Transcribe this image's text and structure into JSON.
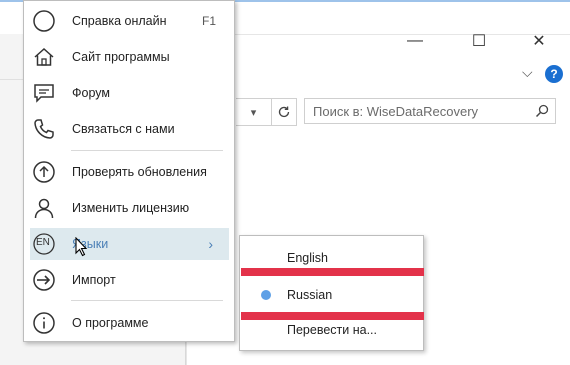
{
  "menu": {
    "items": [
      {
        "label": "Справка онлайн",
        "shortcut": "F1",
        "icon": "help-circle-icon"
      },
      {
        "label": "Сайт программы",
        "icon": "home-icon"
      },
      {
        "label": "Форум",
        "icon": "forum-icon"
      },
      {
        "label": "Связаться с нами",
        "icon": "phone-icon"
      },
      {
        "label": "Проверять обновления",
        "icon": "arrow-up-circle-icon"
      },
      {
        "label": "Изменить лицензию",
        "icon": "person-icon"
      },
      {
        "label": "Языки",
        "icon": "language-icon",
        "badge": "EN"
      },
      {
        "label": "Импорт",
        "icon": "import-icon"
      },
      {
        "label": "О программе",
        "icon": "info-icon"
      }
    ]
  },
  "languages_submenu": {
    "items": [
      {
        "label": "English",
        "selected": false
      },
      {
        "label": "Russian",
        "selected": true
      },
      {
        "label": "Перевести на...",
        "selected": false
      }
    ]
  },
  "search": {
    "placeholder": "Поиск в: WiseDataRecovery"
  },
  "window": {
    "help_label": "?",
    "minimize": "—",
    "maximize": "☐",
    "close": "✕"
  },
  "colors": {
    "highlight": "#dde9ee",
    "accent": "#4a7fb6",
    "annotation_red": "#e3324a",
    "radio": "#5ea0e6"
  }
}
